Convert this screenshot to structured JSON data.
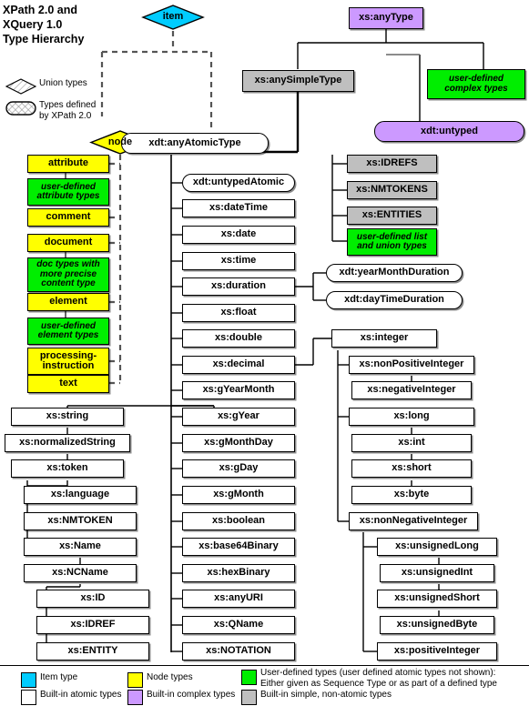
{
  "title": "XPath 2.0 and XQuery 1.0 Type Hierarchy",
  "title_lines": [
    "XPath 2.0 and",
    "XQuery 1.0",
    "Type Hierarchy"
  ],
  "shape_legend": [
    {
      "shape": "diamond",
      "label": "Union types"
    },
    {
      "shape": "rounded-hatched",
      "label": "Types defined by XPath 2.0",
      "line1": "Types defined",
      "line2": "by XPath 2.0"
    }
  ],
  "colors": {
    "item_type": "#00ccff",
    "node_types": "#ffff00",
    "user_defined": "#00ee00",
    "builtin_atomic": "#ffffff",
    "builtin_complex": "#cc99ff",
    "builtin_simple_non_atomic": "#bfbfbf",
    "outline": "#000000",
    "solid_edge": "#000000",
    "dashed_edge": "#555555"
  },
  "roots": {
    "item": "item",
    "node": "node",
    "any_type": "xs:anyType",
    "any_simple_type": "xs:anySimpleType",
    "any_atomic_type": "xdt:anyAtomicType",
    "untyped": "xdt:untyped",
    "user_defined_complex": "user-defined complex types",
    "user_defined_complex_lines": [
      "user-defined",
      "complex types"
    ]
  },
  "node_types_column": [
    {
      "label": "attribute",
      "kind": "node"
    },
    {
      "label": "user-defined attribute types",
      "lines": [
        "user-defined",
        "attribute types"
      ],
      "kind": "user"
    },
    {
      "label": "comment",
      "kind": "node"
    },
    {
      "label": "document",
      "kind": "node"
    },
    {
      "label": "doc types with more precise content type",
      "lines": [
        "doc types with",
        "more precise",
        "content type"
      ],
      "kind": "user"
    },
    {
      "label": "element",
      "kind": "node"
    },
    {
      "label": "user-defined element types",
      "lines": [
        "user-defined",
        "element types"
      ],
      "kind": "user"
    },
    {
      "label": "processing-instruction",
      "lines": [
        "processing-",
        "instruction"
      ],
      "kind": "node"
    },
    {
      "label": "text",
      "kind": "node"
    }
  ],
  "atomic_column": [
    {
      "label": "xdt:untypedAtomic",
      "kind": "xpath2"
    },
    {
      "label": "xs:dateTime",
      "kind": "atomic"
    },
    {
      "label": "xs:date",
      "kind": "atomic"
    },
    {
      "label": "xs:time",
      "kind": "atomic"
    },
    {
      "label": "xs:duration",
      "kind": "atomic"
    },
    {
      "label": "xs:float",
      "kind": "atomic"
    },
    {
      "label": "xs:double",
      "kind": "atomic"
    },
    {
      "label": "xs:decimal",
      "kind": "atomic"
    },
    {
      "label": "xs:gYearMonth",
      "kind": "atomic"
    },
    {
      "label": "xs:gYear",
      "kind": "atomic"
    },
    {
      "label": "xs:gMonthDay",
      "kind": "atomic"
    },
    {
      "label": "xs:gDay",
      "kind": "atomic"
    },
    {
      "label": "xs:gMonth",
      "kind": "atomic"
    },
    {
      "label": "xs:boolean",
      "kind": "atomic"
    },
    {
      "label": "xs:base64Binary",
      "kind": "atomic"
    },
    {
      "label": "xs:hexBinary",
      "kind": "atomic"
    },
    {
      "label": "xs:anyURI",
      "kind": "atomic"
    },
    {
      "label": "xs:QName",
      "kind": "atomic"
    },
    {
      "label": "xs:NOTATION",
      "kind": "atomic"
    }
  ],
  "simple_non_atomic_column": [
    {
      "label": "xs:IDREFS",
      "kind": "simple"
    },
    {
      "label": "xs:NMTOKENS",
      "kind": "simple"
    },
    {
      "label": "xs:ENTITIES",
      "kind": "simple"
    },
    {
      "label": "user-defined list and union types",
      "lines": [
        "user-defined list",
        "and union types"
      ],
      "kind": "user"
    }
  ],
  "duration_children": [
    {
      "label": "xdt:yearMonthDuration",
      "kind": "xpath2"
    },
    {
      "label": "xdt:dayTimeDuration",
      "kind": "xpath2"
    }
  ],
  "string_branch": [
    {
      "label": "xs:string",
      "kind": "atomic"
    },
    {
      "label": "xs:normalizedString",
      "kind": "atomic"
    },
    {
      "label": "xs:token",
      "kind": "atomic"
    },
    {
      "label": "xs:language",
      "kind": "atomic"
    },
    {
      "label": "xs:NMTOKEN",
      "kind": "atomic"
    },
    {
      "label": "xs:Name",
      "kind": "atomic"
    },
    {
      "label": "xs:NCName",
      "kind": "atomic"
    },
    {
      "label": "xs:ID",
      "kind": "atomic"
    },
    {
      "label": "xs:IDREF",
      "kind": "atomic"
    },
    {
      "label": "xs:ENTITY",
      "kind": "atomic"
    }
  ],
  "integer_branch": [
    {
      "label": "xs:integer",
      "kind": "atomic"
    },
    {
      "label": "xs:nonPositiveInteger",
      "kind": "atomic"
    },
    {
      "label": "xs:negativeInteger",
      "kind": "atomic"
    },
    {
      "label": "xs:long",
      "kind": "atomic"
    },
    {
      "label": "xs:int",
      "kind": "atomic"
    },
    {
      "label": "xs:short",
      "kind": "atomic"
    },
    {
      "label": "xs:byte",
      "kind": "atomic"
    },
    {
      "label": "xs:nonNegativeInteger",
      "kind": "atomic"
    },
    {
      "label": "xs:unsignedLong",
      "kind": "atomic"
    },
    {
      "label": "xs:unsignedInt",
      "kind": "atomic"
    },
    {
      "label": "xs:unsignedShort",
      "kind": "atomic"
    },
    {
      "label": "xs:unsignedByte",
      "kind": "atomic"
    },
    {
      "label": "xs:positiveInteger",
      "kind": "atomic"
    }
  ],
  "legend": [
    {
      "color": "#00ccff",
      "label": "Item type"
    },
    {
      "color": "#ffffff",
      "label": "Built-in atomic types"
    },
    {
      "color": "#ffff00",
      "label": "Node types"
    },
    {
      "color": "#cc99ff",
      "label": "Built-in complex types"
    },
    {
      "color": "#00ee00",
      "label": "User-defined types (user defined atomic types not shown): Either given as Sequence Type or as part of a defined type",
      "line1": "User-defined types (user defined atomic types not shown):",
      "line2": "Either given as Sequence Type or as part of a defined type"
    },
    {
      "color": "#bfbfbf",
      "label": "Built-in simple, non-atomic types"
    }
  ]
}
